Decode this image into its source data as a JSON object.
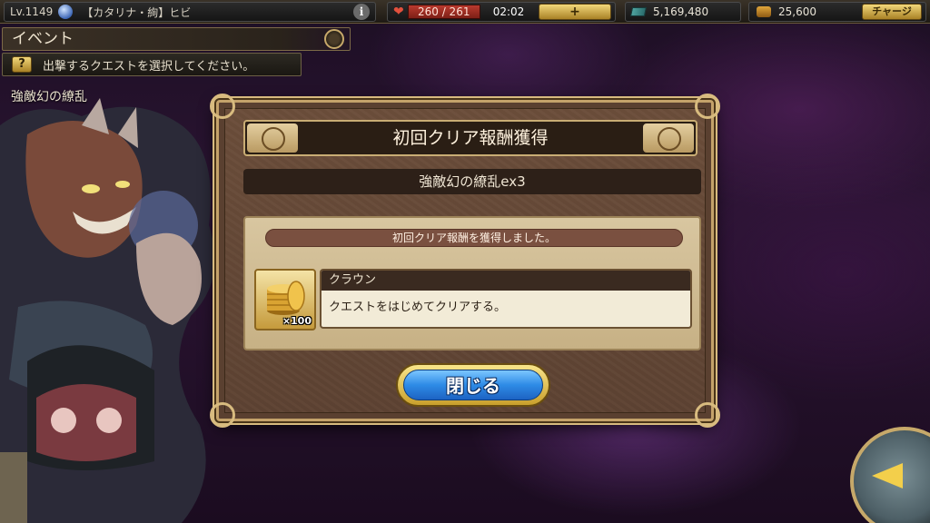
{
  "status_bar": {
    "level": "Lv.1149",
    "player_name": "【カタリナ・絢】ヒビ",
    "info_icon": "i",
    "stamina_current": "260",
    "stamina_separator": "/",
    "stamina_max": "261",
    "stamina_text": "260 / 261",
    "recovery_time": "02:02",
    "add_stamina_label": "+",
    "gold": "5,169,480",
    "crowns": "25,600",
    "charge_label": "チャージ"
  },
  "event": {
    "title": "イベント",
    "hint_icon": "?",
    "hint": "出撃するクエストを選択してください。",
    "quest_name": "強敵幻の繚乱"
  },
  "dialog": {
    "title": "初回クリア報酬獲得",
    "quest_name": "強敵幻の繚乱ex3",
    "message": "初回クリア報酬を獲得しました。",
    "reward": {
      "icon": "crown-coins-icon",
      "quantity": "×100",
      "name": "クラウン",
      "description": "クエストをはじめてクリアする。"
    },
    "close_label": "閉じる"
  },
  "colors": {
    "accent_gold": "#c4a26a",
    "button_blue": "#2e8be6",
    "stamina_red": "#b93a2e"
  }
}
